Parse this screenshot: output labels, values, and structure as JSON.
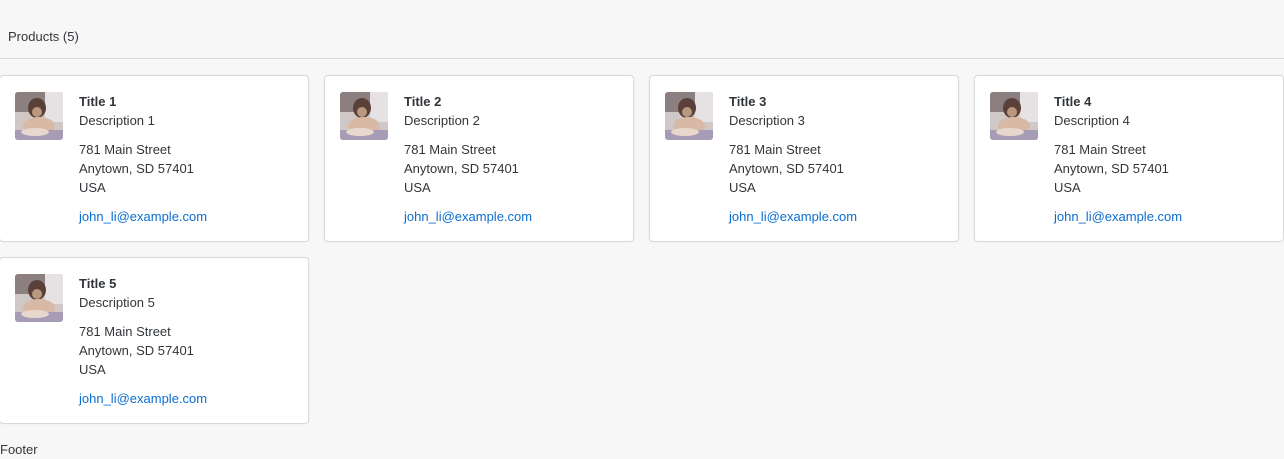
{
  "header": {
    "title": "Products (5)"
  },
  "cards": [
    {
      "title": "Title 1",
      "description": "Description 1",
      "address_line1": "781 Main Street",
      "address_line2": "Anytown, SD 57401",
      "address_line3": "USA",
      "email": "john_li@example.com",
      "image_icon": "dog-photo"
    },
    {
      "title": "Title 2",
      "description": "Description 2",
      "address_line1": "781 Main Street",
      "address_line2": "Anytown, SD 57401",
      "address_line3": "USA",
      "email": "john_li@example.com",
      "image_icon": "dog-photo"
    },
    {
      "title": "Title 3",
      "description": "Description 3",
      "address_line1": "781 Main Street",
      "address_line2": "Anytown, SD 57401",
      "address_line3": "USA",
      "email": "john_li@example.com",
      "image_icon": "dog-photo"
    },
    {
      "title": "Title 4",
      "description": "Description 4",
      "address_line1": "781 Main Street",
      "address_line2": "Anytown, SD 57401",
      "address_line3": "USA",
      "email": "john_li@example.com",
      "image_icon": "dog-photo"
    },
    {
      "title": "Title 5",
      "description": "Description 5",
      "address_line1": "781 Main Street",
      "address_line2": "Anytown, SD 57401",
      "address_line3": "USA",
      "email": "john_li@example.com",
      "image_icon": "dog-photo"
    }
  ],
  "footer": {
    "label": "Footer"
  },
  "colors": {
    "background": "#f7f7f7",
    "card": "#ffffff",
    "link": "#0a6ed1",
    "text": "#32363a",
    "border": "#d9d9d9"
  }
}
